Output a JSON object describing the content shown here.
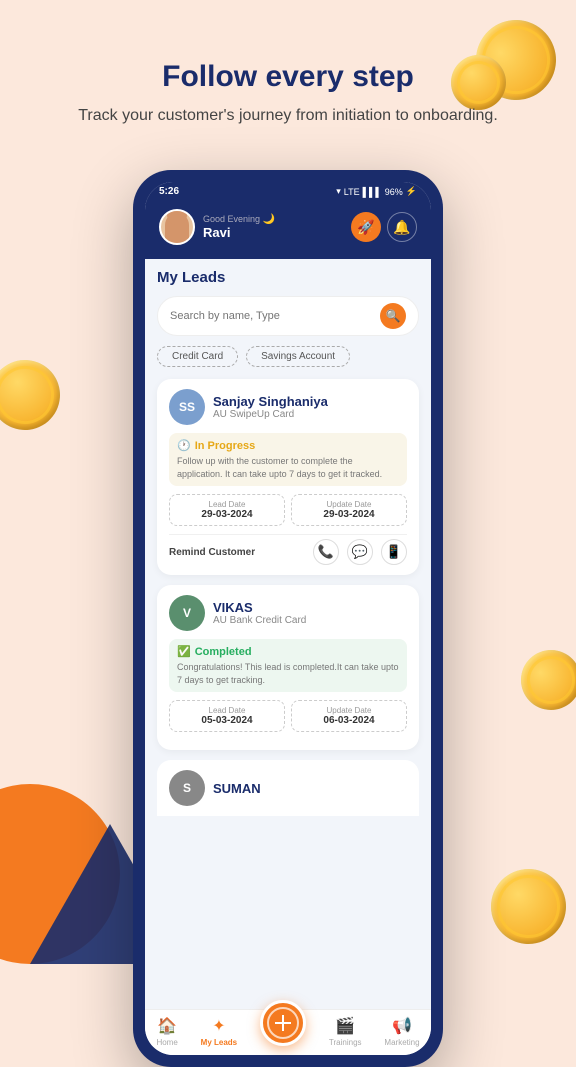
{
  "hero": {
    "title": "Follow every step",
    "subtitle": "Track your customer's journey from initiation to onboarding."
  },
  "status_bar": {
    "time": "5:26",
    "battery": "96%"
  },
  "app_header": {
    "greeting": "Good Evening",
    "user_name": "Ravi"
  },
  "my_leads": {
    "title": "My Leads",
    "search_placeholder": "Search by name, Type",
    "filters": [
      "Credit Card",
      "Savings Account"
    ]
  },
  "leads": [
    {
      "initials": "SS",
      "name": "Sanjay Singhaniya",
      "sub": "AU SwipeUp Card",
      "status": "In Progress",
      "status_type": "in_progress",
      "status_desc": "Follow up with the customer to complete the application. It can take upto 7 days to get it tracked.",
      "lead_date_label": "Lead Date",
      "lead_date": "29-03-2024",
      "update_date_label": "Update Date",
      "update_date": "29-03-2024",
      "remind": "Remind Customer",
      "avatar_class": "avatar-blue"
    },
    {
      "initials": "V",
      "name": "VIKAS",
      "sub": "AU Bank Credit Card",
      "status": "Completed",
      "status_type": "completed",
      "status_desc": "Congratulations! This lead is completed.It can take upto 7 days to get tracking.",
      "lead_date_label": "Lead Date",
      "lead_date": "05-03-2024",
      "update_date_label": "Update Date",
      "update_date": "06-03-2024",
      "remind": null,
      "avatar_class": "avatar-green"
    },
    {
      "initials": "S",
      "name": "SUMAN",
      "sub": "",
      "status": "",
      "avatar_class": "avatar-gray"
    }
  ],
  "bottom_nav": {
    "items": [
      {
        "label": "Home",
        "icon": "🏠",
        "active": false
      },
      {
        "label": "My Leads",
        "icon": "✦",
        "active": true
      },
      {
        "label": "",
        "icon": "+",
        "active": false,
        "fab": true
      },
      {
        "label": "Trainings",
        "icon": "🎬",
        "active": false
      },
      {
        "label": "Marketing",
        "icon": "📢",
        "active": false
      }
    ]
  }
}
